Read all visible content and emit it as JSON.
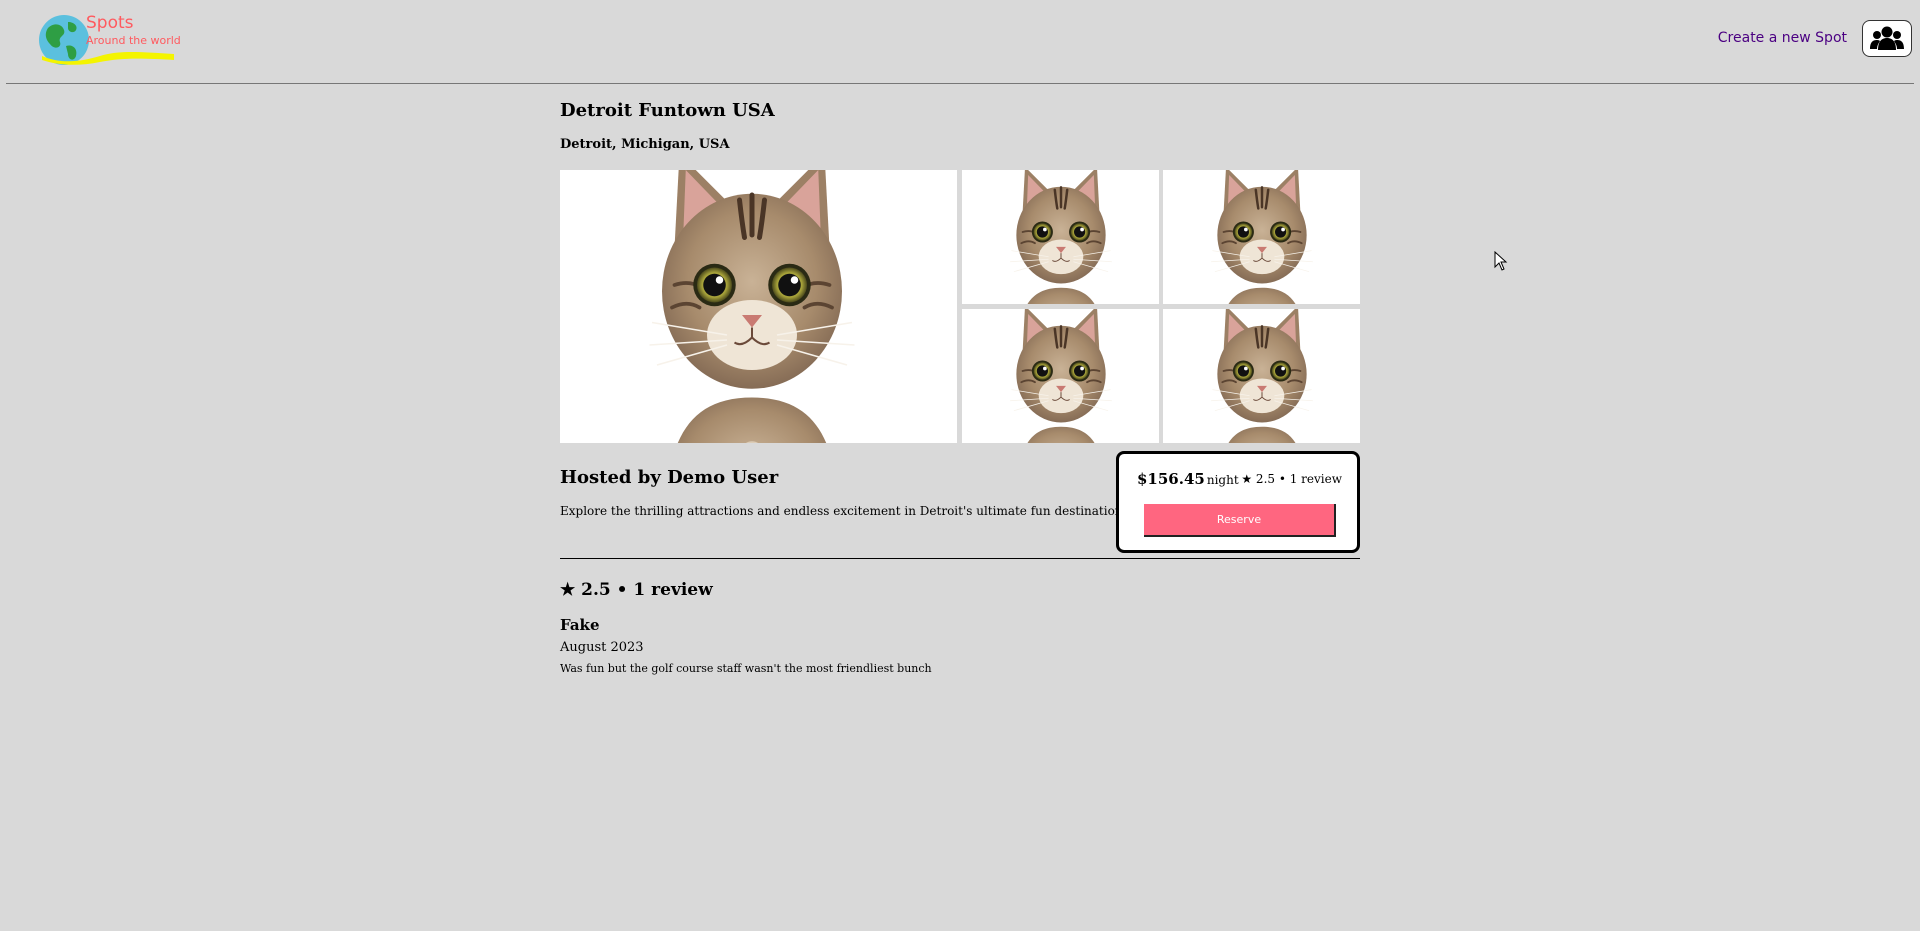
{
  "header": {
    "logo": {
      "title": "Spots",
      "subtitle": "Around the world"
    },
    "create_link": "Create a new Spot",
    "user_menu_icon": "users-icon"
  },
  "spot": {
    "title": "Detroit Funtown USA",
    "location": "Detroit, Michigan, USA",
    "images": [
      "cat-photo",
      "cat-photo",
      "cat-photo",
      "cat-photo",
      "cat-photo"
    ],
    "host": "Hosted by Demo User",
    "description": "Explore the thrilling attractions and endless excitement in Detroit's ultimate fun destination!"
  },
  "booking": {
    "price": "$156.45",
    "price_unit": "night",
    "rating": "★ 2.5 • 1 review",
    "reserve_label": "Reserve"
  },
  "reviews": {
    "heading": "★ 2.5 • 1 review",
    "items": [
      {
        "name": "Fake",
        "date": "August 2023",
        "text": "Was fun but the golf course staff wasn't the most friendliest bunch"
      }
    ]
  },
  "colors": {
    "page_background": "#d9d9d9",
    "logo_text": "#ff5a5f",
    "link": "#4b0082",
    "reserve_button": "#ff6680"
  }
}
